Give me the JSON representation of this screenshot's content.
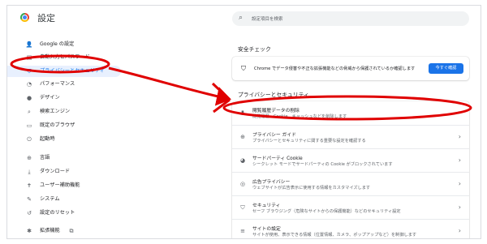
{
  "app": {
    "title": "設定"
  },
  "search": {
    "placeholder": "設定項目を検索"
  },
  "sidebar": {
    "items": [
      {
        "label": "Google の設定",
        "icon": "person-icon",
        "glyph": "👤"
      },
      {
        "label": "自動入力とパスワード",
        "icon": "clipboard-icon",
        "glyph": "▤"
      },
      {
        "label": "プライバシーとセキュリティ",
        "icon": "shield-icon",
        "glyph": "⛉",
        "active": true
      },
      {
        "label": "パフォーマンス",
        "icon": "speedometer-icon",
        "glyph": "◔"
      },
      {
        "label": "デザイン",
        "icon": "palette-icon",
        "glyph": "●"
      },
      {
        "label": "検索エンジン",
        "icon": "search-icon",
        "glyph": "⌕"
      },
      {
        "label": "既定のブラウザ",
        "icon": "browser-icon",
        "glyph": "▭"
      },
      {
        "label": "起動時",
        "icon": "power-icon",
        "glyph": "⏻"
      },
      {
        "label": "言語",
        "icon": "globe-icon",
        "glyph": "⊕"
      },
      {
        "label": "ダウンロード",
        "icon": "download-icon",
        "glyph": "⤓"
      },
      {
        "label": "ユーザー補助機能",
        "icon": "accessibility-icon",
        "glyph": "✝"
      },
      {
        "label": "システム",
        "icon": "wrench-icon",
        "glyph": "✎"
      },
      {
        "label": "設定のリセット",
        "icon": "reset-icon",
        "glyph": "↺"
      },
      {
        "label": "拡張機能",
        "icon": "puzzle-icon",
        "glyph": "✱",
        "extra_icon": "open-in-new-icon",
        "extra_glyph": "⧉"
      }
    ]
  },
  "safety_check": {
    "heading": "安全チェック",
    "text": "Chrome でデータ侵害や不正な拡張機能などの脅威から保護されているか確認します",
    "button": "今すぐ確認",
    "icon": "shield-check-icon"
  },
  "privacy": {
    "heading": "プライバシーとセキュリティ",
    "rows": [
      {
        "title": "閲覧履歴データの削除",
        "subtitle": "閲覧履歴、Cookie、キャッシュなどを削除します",
        "icon": "trash-icon",
        "glyph": "▮"
      },
      {
        "title": "プライバシー ガイド",
        "subtitle": "プライバシーとセキュリティに関する重要な設定を確認する",
        "icon": "privacy-guide-icon",
        "glyph": "⊕"
      },
      {
        "title": "サードパーティ Cookie",
        "subtitle": "シークレット モードでサードパーティの Cookie がブロックされています",
        "icon": "cookie-icon",
        "glyph": "◕"
      },
      {
        "title": "広告プライバシー",
        "subtitle": "ウェブサイトが広告表示に使用する情報をカスタマイズします",
        "icon": "ad-privacy-icon",
        "glyph": "◎"
      },
      {
        "title": "セキュリティ",
        "subtitle": "セーフ ブラウジング（危険なサイトからの保護機能）などのセキュリティ設定",
        "icon": "security-shield-icon",
        "glyph": "⛉"
      },
      {
        "title": "サイトの設定",
        "subtitle": "サイトが使用、表示できる情報（位置情報、カメラ、ポップアップなど）を制御します",
        "icon": "sliders-icon",
        "glyph": "≡"
      }
    ]
  },
  "annotation": {
    "color": "#e00000"
  }
}
